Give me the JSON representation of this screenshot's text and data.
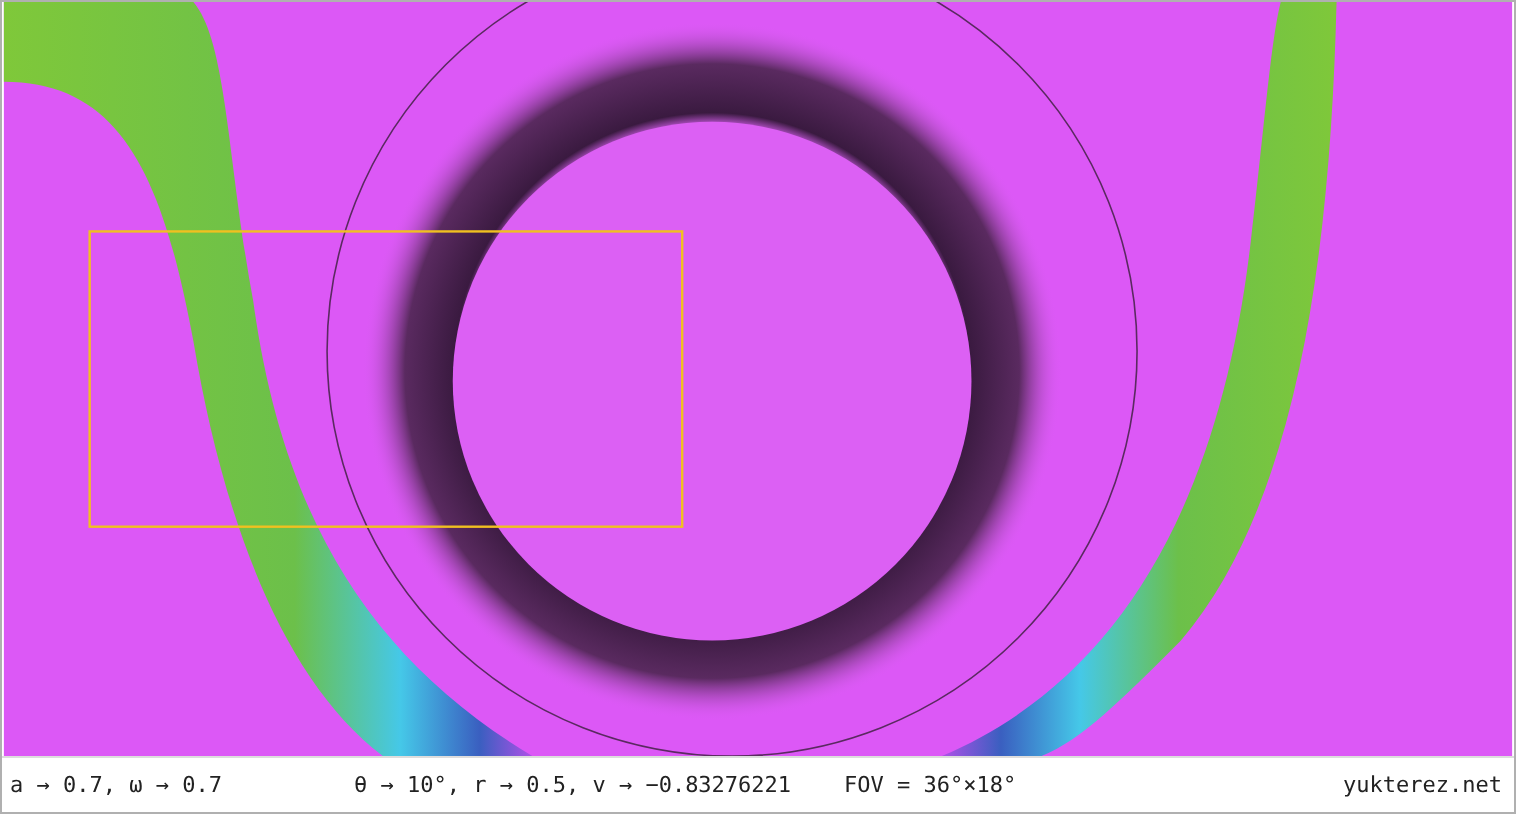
{
  "status_bar": {
    "groups": [
      "a → 0.7, ω → 0.7",
      "θ → 10°, r → 0.5, v → −0.83276221",
      "FOV = 36°×18°"
    ],
    "site": "yukterez.net"
  }
}
